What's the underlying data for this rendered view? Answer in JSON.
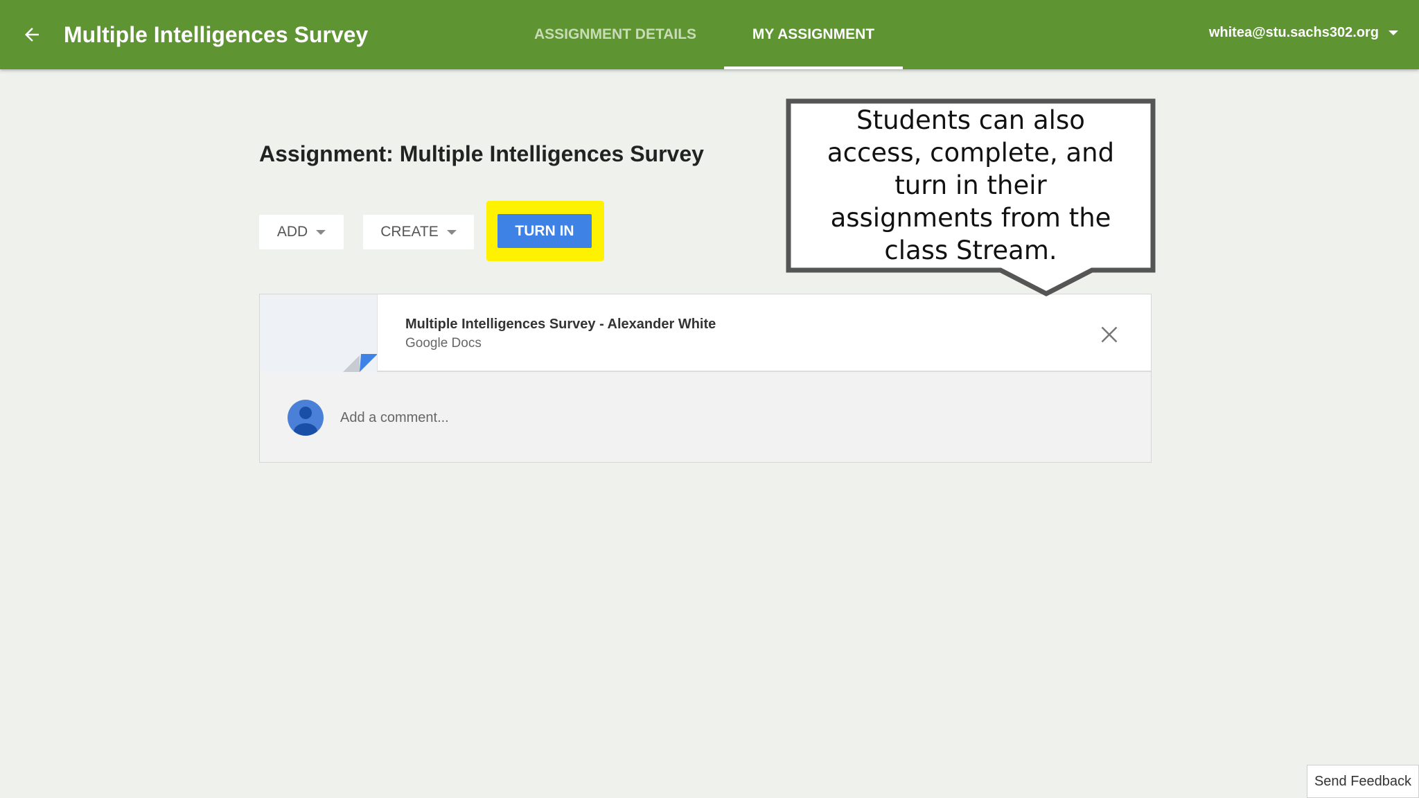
{
  "header": {
    "back_icon": "arrow-left-icon",
    "title": "Multiple Intelligences Survey",
    "tabs": [
      {
        "label": "ASSIGNMENT DETAILS",
        "active": false
      },
      {
        "label": "MY ASSIGNMENT",
        "active": true
      }
    ],
    "account": "whitea@stu.sachs302.org",
    "bar_color": "#5e9432"
  },
  "main": {
    "title": "Assignment: Multiple Intelligences Survey",
    "buttons": {
      "add": "ADD",
      "create": "CREATE",
      "turn_in": "TURN IN"
    },
    "attachment": {
      "name": "Multiple Intelligences Survey - Alexander White",
      "type": "Google Docs"
    },
    "comment": {
      "placeholder": "Add a comment..."
    }
  },
  "callout": {
    "lines": [
      "Students can also",
      "access, complete, and",
      "turn in their",
      "assignments from the",
      "class Stream."
    ]
  },
  "footer": {
    "feedback": "Send Feedback"
  },
  "colors": {
    "accent_blue": "#3f82e6",
    "highlight_yellow": "#fff200"
  }
}
